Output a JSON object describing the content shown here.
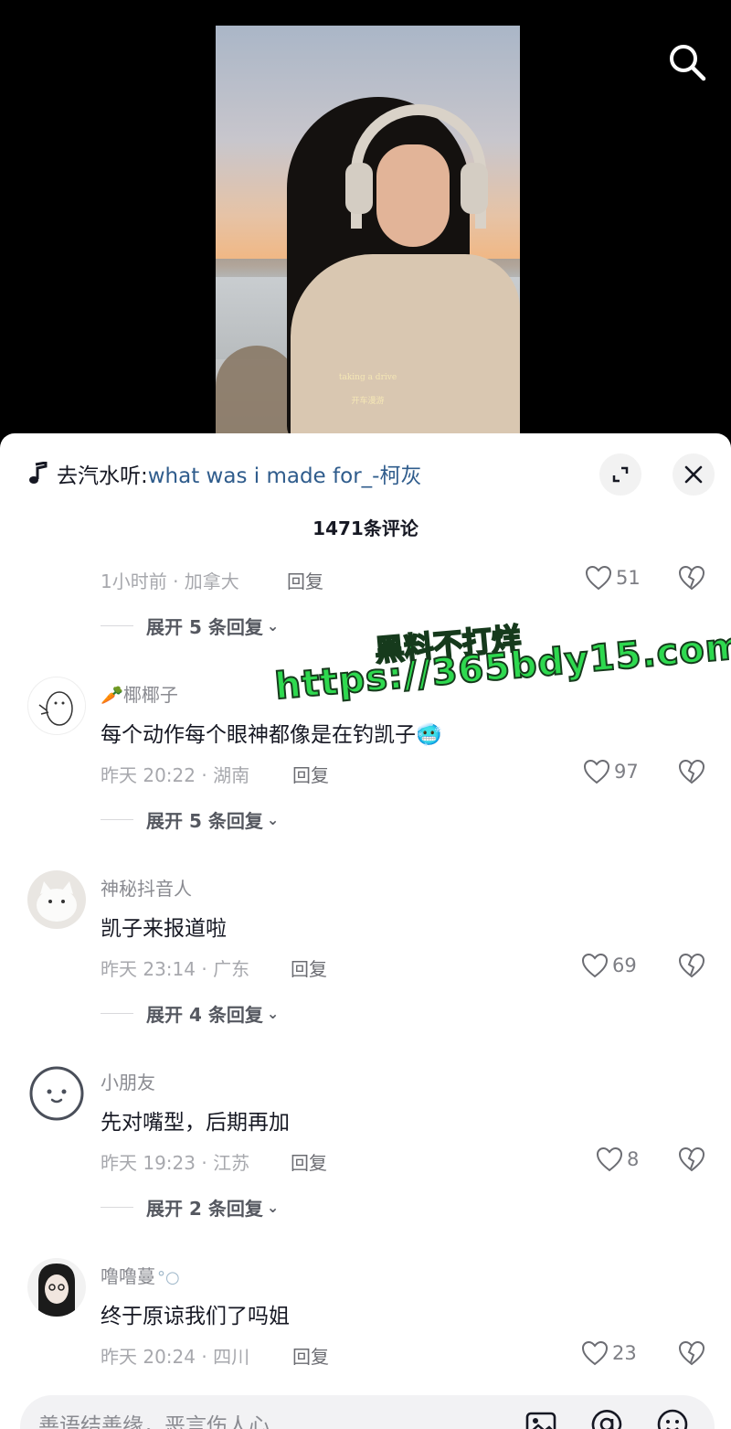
{
  "video": {
    "subtitle_line_1": "taking a drive",
    "subtitle_line_2": "开车漫游"
  },
  "music": {
    "prefix": "去汽水听:",
    "title": "what was i made for_-柯灰"
  },
  "comment_count": "1471条评论",
  "comments": [
    {
      "meta": "1小时前 · 加拿大",
      "reply_label": "回复",
      "likes": "51",
      "expand_label": "展开 5 条回复"
    },
    {
      "username": "椰椰子",
      "username_emoji": "🥕",
      "text": "每个动作每个眼神都像是在钓凯子",
      "text_emoji": "🥶",
      "meta": "昨天 20:22 · 湖南",
      "reply_label": "回复",
      "likes": "97",
      "expand_label": "展开 5 条回复"
    },
    {
      "username": "神秘抖音人",
      "text": "凯子来报道啦",
      "meta": "昨天 23:14 · 广东",
      "reply_label": "回复",
      "likes": "69",
      "expand_label": "展开 4 条回复"
    },
    {
      "username": "小朋友",
      "text": "先对嘴型，后期再加",
      "meta": "昨天 19:23 · 江苏",
      "reply_label": "回复",
      "likes": "8",
      "expand_label": "展开 2 条回复"
    },
    {
      "username": "噜噜蔓",
      "text": "终于原谅我们了吗姐",
      "meta": "昨天 20:24 · 四川",
      "reply_label": "回复",
      "likes": "23"
    }
  ],
  "watermark": {
    "line_1": "黑料不打烊",
    "line_2": "https://365bdy15.com"
  },
  "input": {
    "placeholder": "善语结善缘，恶言伤人心"
  },
  "icons": {
    "search": "search-icon",
    "music": "music-note-icon",
    "expand": "expand-icon",
    "close": "close-icon",
    "like": "heart-icon",
    "dislike": "broken-heart-icon",
    "image": "image-icon",
    "mention": "at-icon",
    "emoji": "emoji-icon"
  },
  "colors": {
    "music_title": "#2f5c8c",
    "watermark": "#2ed94f"
  }
}
